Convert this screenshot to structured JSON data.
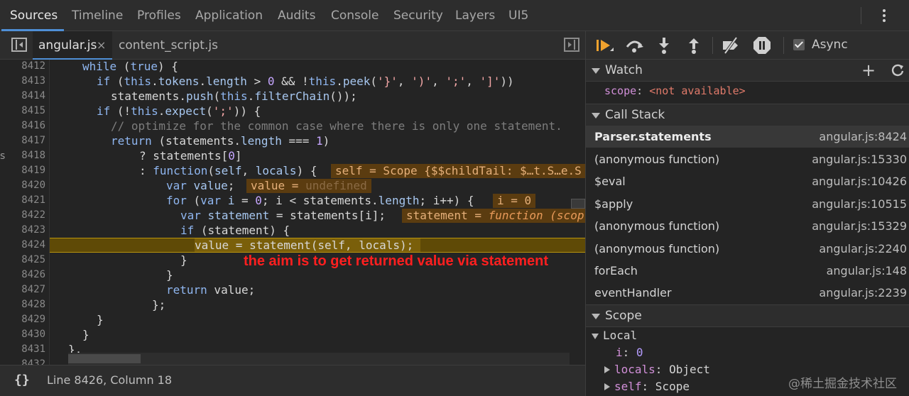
{
  "main_tabs": [
    {
      "label": "Sources",
      "active": true
    },
    {
      "label": "Timeline"
    },
    {
      "label": "Profiles"
    },
    {
      "label": "Application"
    },
    {
      "label": "Audits"
    },
    {
      "label": "Console"
    },
    {
      "label": "Security"
    },
    {
      "label": "Layers"
    },
    {
      "label": "UI5"
    }
  ],
  "editor": {
    "tabs": [
      {
        "label": "angular.js",
        "close": "×",
        "active": true
      },
      {
        "label": "content_script.js"
      }
    ],
    "line_numbers": [
      "8412",
      "8413",
      "8414",
      "8415",
      "8416",
      "8417",
      "8418",
      "8419",
      "8420",
      "8421",
      "8422",
      "8423",
      "8424",
      "8425",
      "8426",
      "8427",
      "8428",
      "8429",
      "8430",
      "8431",
      "8432"
    ],
    "current_line": "8424",
    "inline_values": {
      "self": "self = Scope {$$childTail: $…t.S…e.S",
      "value_label": "value = ",
      "value_val": "undefined",
      "i": "i = 0",
      "statement_label": "statement = ",
      "statement_val": "function (scop"
    },
    "annotation": "the aim is to get returned value via statement",
    "status": "Line 8426, Column 18",
    "format_icon": "{}",
    "left_edge": "s"
  },
  "debugger": {
    "async_label": "Async",
    "async_checked": true,
    "watch": {
      "title": "Watch",
      "add": "+",
      "items": [
        {
          "key": "scope",
          "value": "<not available>"
        }
      ]
    },
    "call_stack": {
      "title": "Call Stack",
      "frames": [
        {
          "fn": "Parser.statements",
          "loc": "angular.js:8424",
          "selected": true
        },
        {
          "fn": "(anonymous function)",
          "loc": "angular.js:15330"
        },
        {
          "fn": "$eval",
          "loc": "angular.js:10426"
        },
        {
          "fn": "$apply",
          "loc": "angular.js:10515"
        },
        {
          "fn": "(anonymous function)",
          "loc": "angular.js:15329"
        },
        {
          "fn": "(anonymous function)",
          "loc": "angular.js:2240"
        },
        {
          "fn": "forEach",
          "loc": "angular.js:148"
        },
        {
          "fn": "eventHandler",
          "loc": "angular.js:2239"
        }
      ]
    },
    "scope": {
      "title": "Scope",
      "local_label": "Local",
      "vars": [
        {
          "key": "i",
          "value": "0"
        },
        {
          "key": "locals",
          "value": "Object"
        },
        {
          "key": "self",
          "value": "Scope"
        }
      ]
    }
  },
  "watermark": "@稀土掘金技术社区",
  "colors": {
    "accent": "#4f8fd6",
    "exec_line": "#5f4a06",
    "annotation": "#ff1f1f"
  }
}
